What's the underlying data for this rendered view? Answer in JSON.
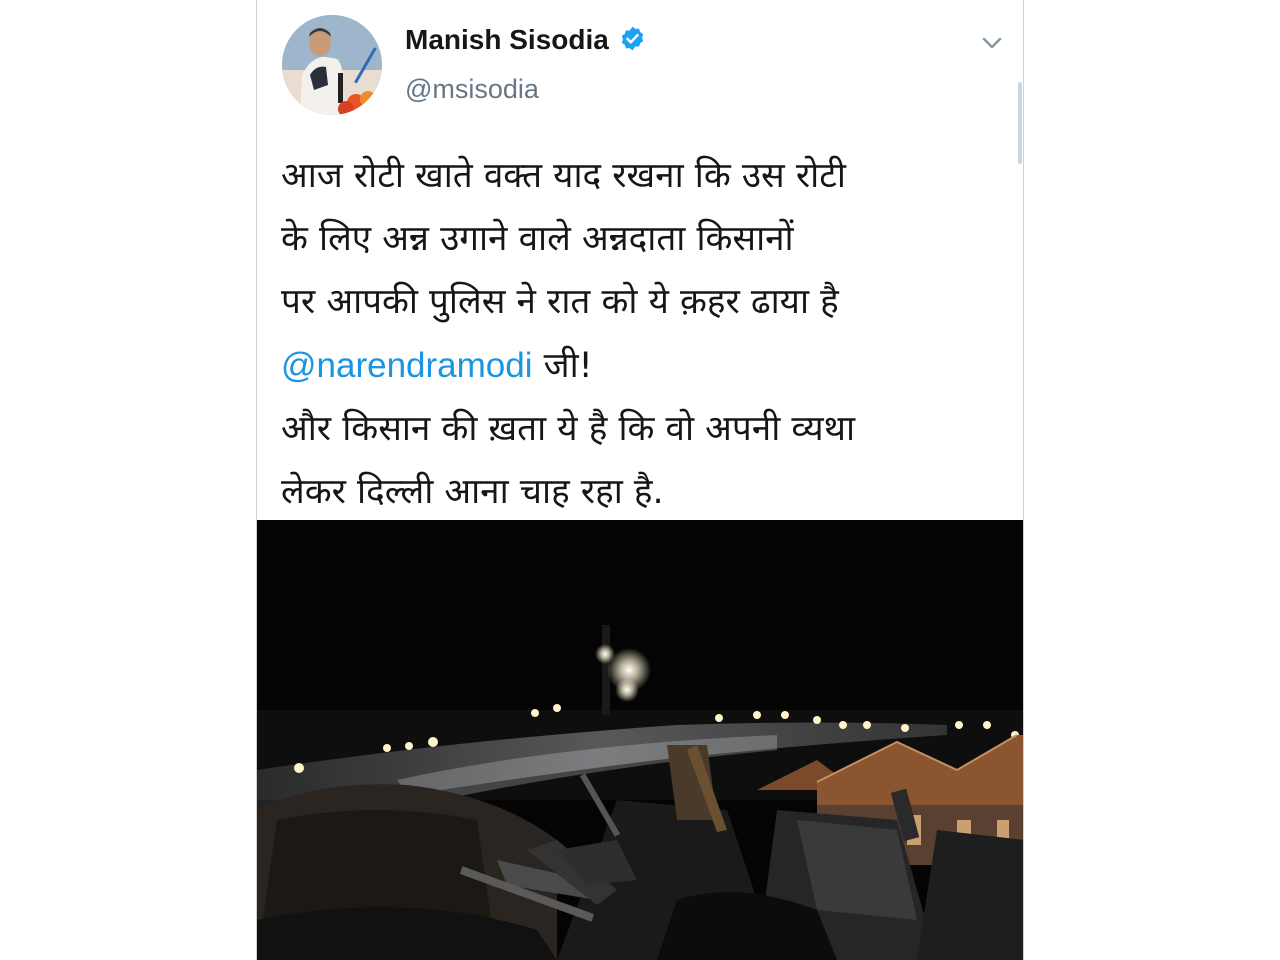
{
  "tweet": {
    "author": {
      "display_name": "Manish Sisodia",
      "handle": "@msisodia",
      "verified": true,
      "verified_color": "#1da1f2"
    },
    "menu_icon": "chevron-down-icon",
    "text": {
      "line1": "आज रोटी खाते वक्त याद रखना कि उस रोटी",
      "line2": "के लिए अन्न उगाने वाले अन्नदाता किसानों",
      "line3": "पर आपकी पुलिस ने रात को ये क़हर ढाया है",
      "mention": "@narendramodi",
      "line4_rest": " जी!",
      "line5": "और किसान की ख़ता ये है कि वो अपनी व्यथा",
      "line6": "लेकर दिल्ली आना चाह रहा है."
    },
    "mention_color": "#1b95e0",
    "media": {
      "type": "photo",
      "scene": "night-water-cannon"
    }
  }
}
